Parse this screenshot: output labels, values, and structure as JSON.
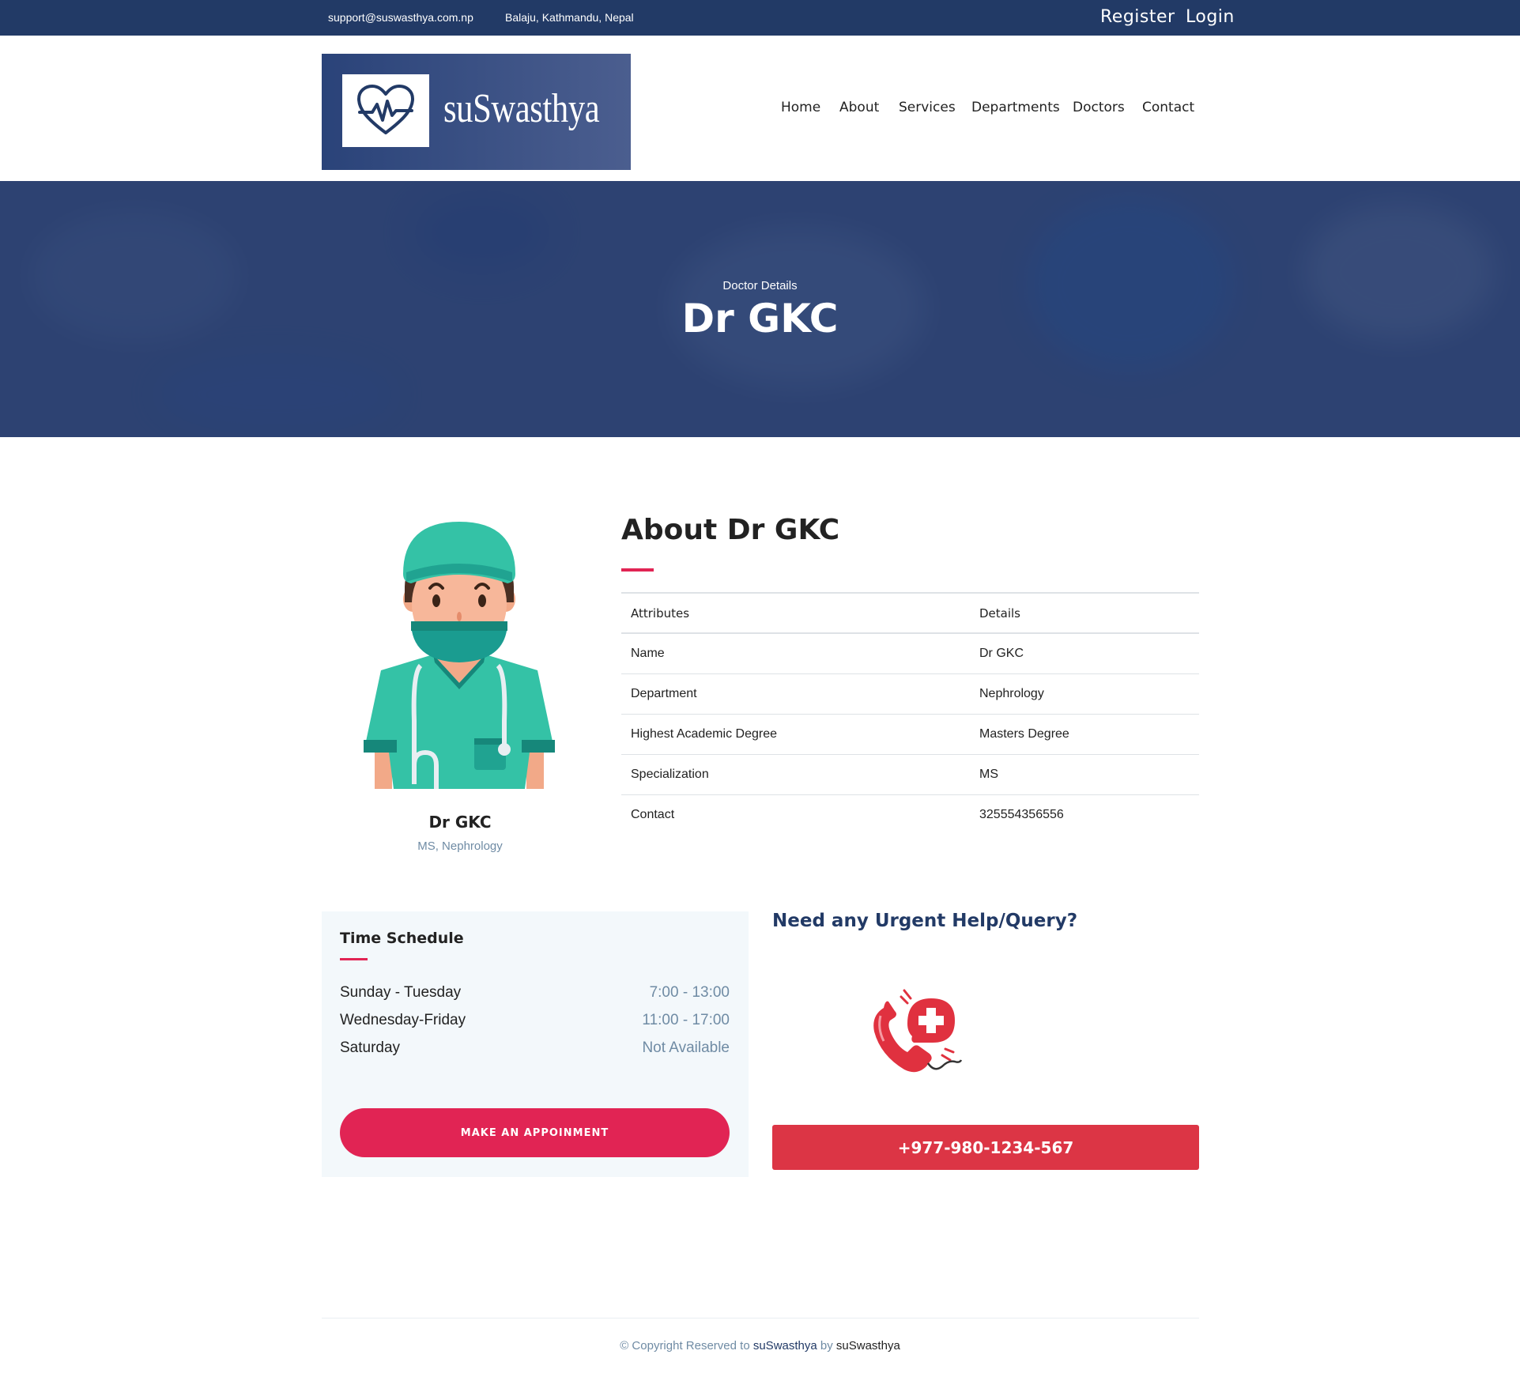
{
  "topbar": {
    "email": "support@suswasthya.com.np",
    "address": "Balaju, Kathmandu, Nepal",
    "register": "Register",
    "login": "Login"
  },
  "brand": {
    "name": "suSwasthya",
    "logo_icon": "heart-pulse-icon"
  },
  "nav": [
    "Home",
    "About",
    "Services",
    "Departments",
    "Doctors",
    "Contact"
  ],
  "hero": {
    "subtitle": "Doctor Details",
    "title": "Dr GKC"
  },
  "doctor": {
    "name": "Dr GKC",
    "subtitle": "MS, Nephrology",
    "illustration": "doctor-illustration"
  },
  "about": {
    "title": "About Dr GKC",
    "headers": [
      "Attributes",
      "Details"
    ],
    "rows": [
      [
        "Name",
        "Dr GKC"
      ],
      [
        "Department",
        "Nephrology"
      ],
      [
        "Highest Academic Degree",
        "Masters Degree"
      ],
      [
        "Specialization",
        "MS"
      ],
      [
        "Contact",
        "325554356556"
      ]
    ]
  },
  "schedule": {
    "title": "Time Schedule",
    "rows": [
      {
        "day": "Sunday - Tuesday",
        "time": "7:00 - 13:00"
      },
      {
        "day": "Wednesday-Friday",
        "time": "11:00 - 17:00"
      },
      {
        "day": "Saturday",
        "time": "Not Available"
      }
    ],
    "button": "MAKE AN APPOINMENT"
  },
  "urgent": {
    "title": "Need any Urgent Help/Query?",
    "phone": "+977-980-1234-567",
    "icon": "emergency-phone-icon"
  },
  "footer": {
    "prefix": "© Copyright Reserved to ",
    "brand": "suSwasthya",
    "middle": " by ",
    "author": "suSwasthya"
  },
  "colors": {
    "primary": "#223a66",
    "accent": "#e12454",
    "danger": "#dc3545",
    "muted": "#6f8ba4"
  }
}
